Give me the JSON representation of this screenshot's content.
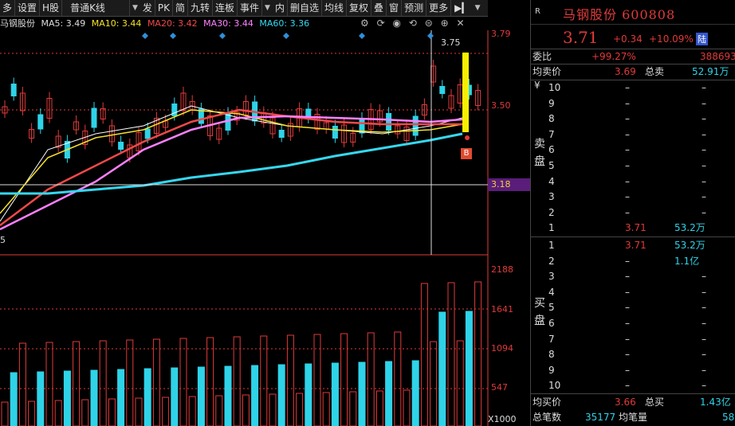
{
  "toolbar": {
    "items": [
      "多",
      "设置",
      "H股",
      "普通K线",
      "发",
      "PK",
      "简",
      "九转",
      "连板",
      "事件",
      "内",
      "删自选",
      "均线",
      "复权",
      "叠",
      "窗",
      "预测",
      "更多"
    ]
  },
  "ma": {
    "name": "马钢股份",
    "ma5": "MA5: 3.49",
    "ma10": "MA10: 3.44",
    "ma20": "MA20: 3.42",
    "ma30": "MA30: 3.44",
    "ma60": "MA60: 3.36"
  },
  "colors": {
    "up": "#e03a3a",
    "down": "#2fd3e8",
    "ma5": "#ffffff",
    "ma10": "#f5e22a",
    "ma20": "#f04848",
    "ma30": "#ff80ff",
    "ma60": "#35d8f0",
    "limit_bar": "#f5f000"
  },
  "price_axis": {
    "top": "3.79",
    "mid": "3.50",
    "cross": "3.18",
    "peak_marker": "3.75",
    "low_marker": "5"
  },
  "vol_axis": {
    "v1": "2188",
    "v2": "1641",
    "v3": "1094",
    "v4": "547",
    "unit": "X1000"
  },
  "badge_b": "B",
  "quote": {
    "market_tag": "R",
    "title": "马钢股份 600808",
    "price": "3.71",
    "change": "+0.34",
    "pct": "+10.09%",
    "tag": "陆",
    "weibi_label": "委比",
    "weibi_value": "+99.27%",
    "weibi_right": "388693",
    "avg_sell_label": "均卖价",
    "avg_sell": "3.69",
    "total_sell_label": "总卖",
    "total_sell": "52.91万",
    "sell_label": "卖盘",
    "buy_label": "买盘",
    "yen": "¥",
    "sell": [
      {
        "lvl": "10",
        "p": "–",
        "v": "–"
      },
      {
        "lvl": "9",
        "p": "–",
        "v": "–"
      },
      {
        "lvl": "8",
        "p": "–",
        "v": "–"
      },
      {
        "lvl": "7",
        "p": "–",
        "v": "–"
      },
      {
        "lvl": "6",
        "p": "–",
        "v": "–"
      },
      {
        "lvl": "5",
        "p": "–",
        "v": "–"
      },
      {
        "lvl": "4",
        "p": "–",
        "v": "–"
      },
      {
        "lvl": "3",
        "p": "–",
        "v": "–"
      },
      {
        "lvl": "2",
        "p": "–",
        "v": "–"
      },
      {
        "lvl": "1",
        "p": "3.71",
        "v": "53.2万"
      }
    ],
    "buy": [
      {
        "lvl": "1",
        "p": "3.71",
        "v": "53.2万"
      },
      {
        "lvl": "2",
        "p": "–",
        "v": "1.1亿"
      },
      {
        "lvl": "3",
        "p": "–",
        "v": "–"
      },
      {
        "lvl": "4",
        "p": "–",
        "v": "–"
      },
      {
        "lvl": "5",
        "p": "–",
        "v": "–"
      },
      {
        "lvl": "6",
        "p": "–",
        "v": "–"
      },
      {
        "lvl": "7",
        "p": "–",
        "v": "–"
      },
      {
        "lvl": "8",
        "p": "–",
        "v": "–"
      },
      {
        "lvl": "9",
        "p": "–",
        "v": "–"
      },
      {
        "lvl": "10",
        "p": "–",
        "v": "–"
      }
    ],
    "avg_buy_label": "均买价",
    "avg_buy": "3.66",
    "total_buy_label": "总买",
    "total_buy": "1.43亿",
    "total_trades_label": "总笔数",
    "total_trades": "35177",
    "avg_per_trade_label": "均笔量",
    "avg_per_trade": "58"
  }
}
